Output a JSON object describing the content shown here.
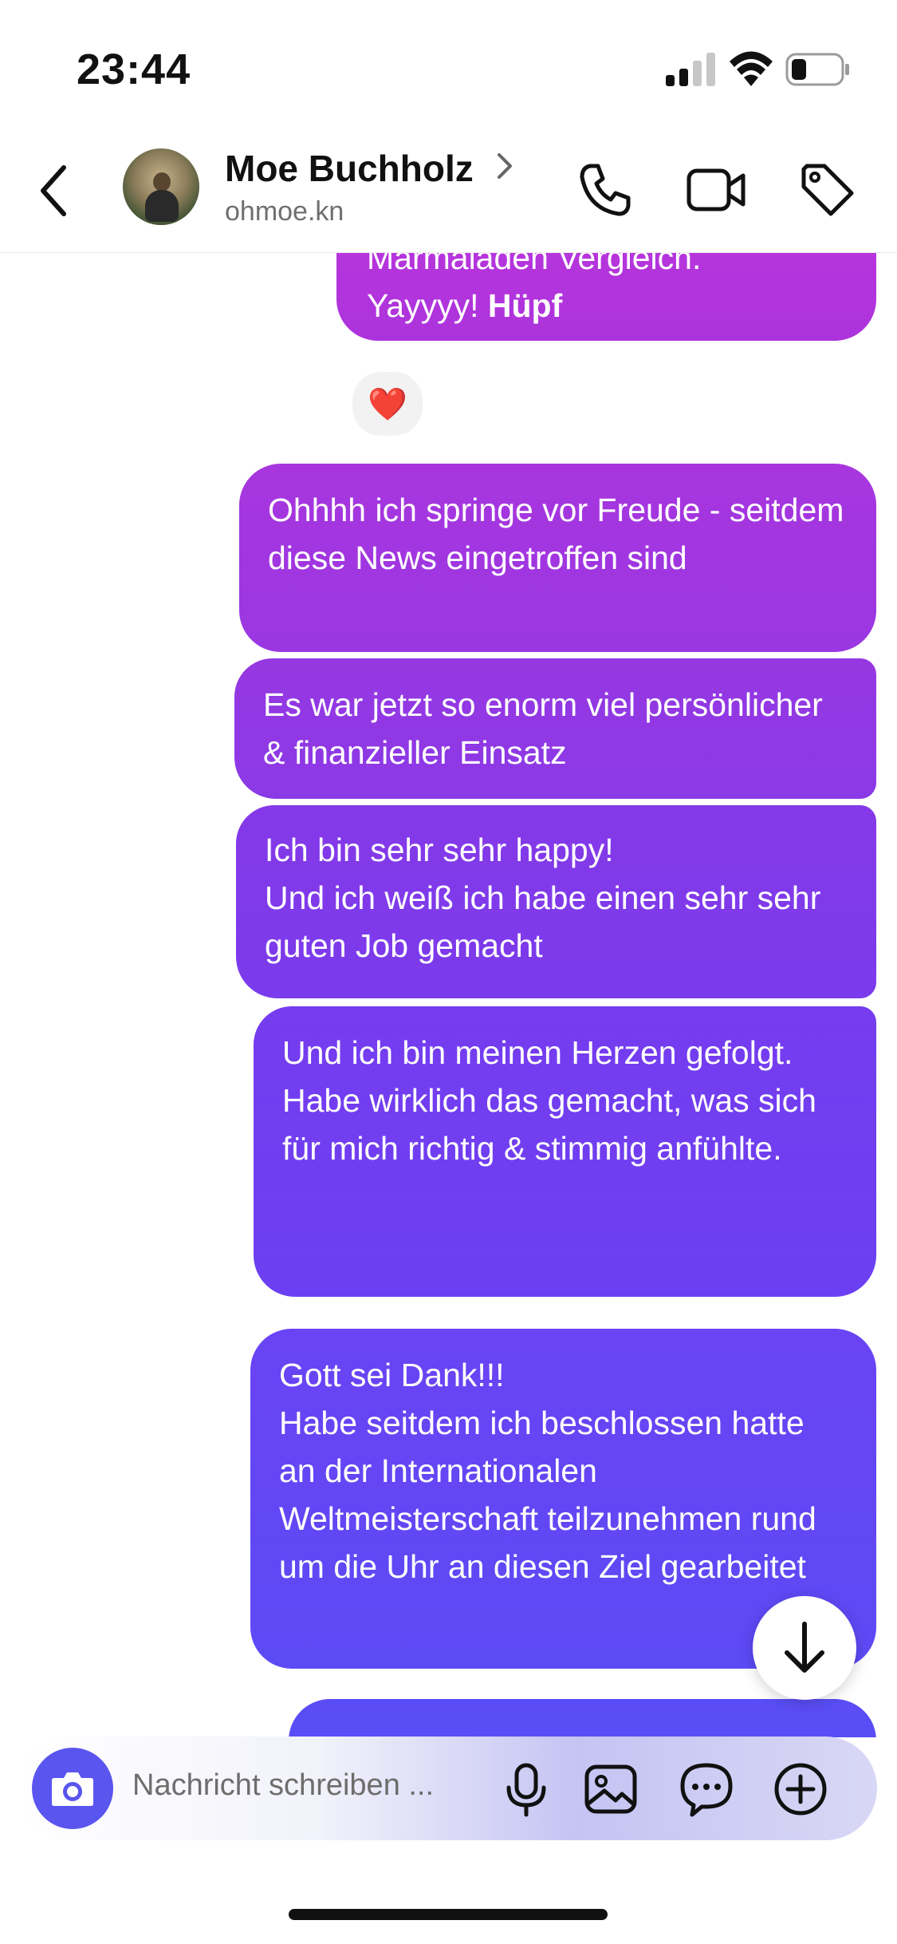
{
  "status_bar": {
    "time": "23:44"
  },
  "header": {
    "contact_name": "Moe Buchholz",
    "contact_handle": "ohmoe.kn",
    "icons": [
      "back-chevron-icon",
      "phone-icon",
      "video-camera-icon",
      "tag-icon"
    ]
  },
  "messages": [
    {
      "id": "m0",
      "lines": [
        "Marmaladen Vergleich."
      ],
      "line2_plain": "Yayyyy! ",
      "line2_bold": "Hüpf",
      "reaction": "❤️"
    },
    {
      "id": "m1",
      "text": "Ohhhh ich springe vor Freude - seitdem diese News eingetroffen sind"
    },
    {
      "id": "m2",
      "text": "Es war jetzt so enorm viel persönlicher & finanzieller Einsatz"
    },
    {
      "id": "m3",
      "p1": "Ich bin sehr sehr happy!",
      "p2": "Und ich weiß ich habe einen sehr sehr guten Job gemacht"
    },
    {
      "id": "m4",
      "p1": "Und ich bin meinen Herzen gefolgt.",
      "p2": "Habe wirklich das gemacht, was sich für mich richtig & stimmig anfühlte."
    },
    {
      "id": "m5",
      "p1": "Gott sei Dank!!!",
      "p2": "Habe seitdem ich beschlossen hatte an der Internationalen Weltmeisterschaft teilzunehmen rund um die Uhr an diesen Ziel gearbeitet"
    }
  ],
  "composer": {
    "placeholder": "Nachricht schreiben ...",
    "icons": [
      "camera-icon",
      "microphone-icon",
      "image-icon",
      "chat-bubble-icon",
      "plus-icon"
    ]
  },
  "colors": {
    "bubble_top": "#b534de",
    "bubble_mid": "#7a3bf2",
    "bubble_bottom": "#5a4cf5",
    "camera_button": "#5a55ee"
  }
}
